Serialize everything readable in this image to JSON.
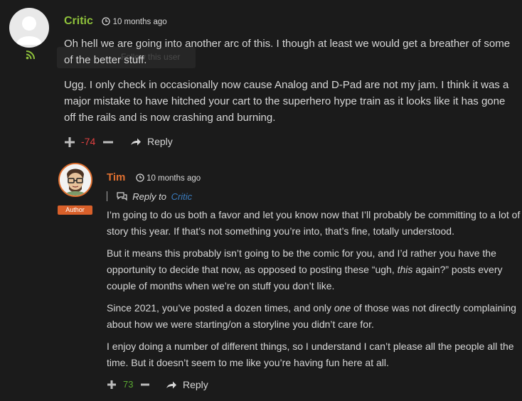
{
  "comment": {
    "author": "Critic",
    "time": "10 months ago",
    "tooltip": "Follow this user",
    "paragraphs": [
      "Oh hell we are going into another arc of this. I though at least we would get a breather of some of the better stuff.",
      "Ugg. I only check in occasionally now cause Analog and D-Pad are not my jam. I think it was a major mistake to have hitched your cart to the superhero hype train as it looks like it has gone off the rails and is now crashing and burning."
    ],
    "score": "-74",
    "reply_label": "Reply"
  },
  "reply": {
    "author": "Tim",
    "badge": "Author",
    "time": "10 months ago",
    "reply_to_prefix": "Reply to",
    "reply_to_name": "Critic",
    "p1": "I’m going to do us both a favor and let you know now that I’ll probably be committing to a lot of story this year. If that’s not something you’re into, that’s fine, totally understood.",
    "p2a": "But it means this probably isn’t going to be the comic for you, and I’d rather you have the opportunity to decide that now, as opposed to posting these “ugh, ",
    "p2em": "this",
    "p2b": " again?” posts every couple of months when we’re on stuff you don’t like.",
    "p3a": "Since 2021, you’ve posted a dozen times, and only ",
    "p3em": "one",
    "p3b": " of those was not directly complaining about how we were starting/on a storyline you didn’t care for.",
    "p4": "I enjoy doing a number of different things, so I understand I can’t please all the people all the time. But it doesn’t seem to me like you’re having fun here at all.",
    "score": "73",
    "reply_label": "Reply"
  },
  "colors": {
    "critic_name": "#8fc23b",
    "tim_name": "#e07030",
    "negative": "#e04040",
    "positive": "#5aa832",
    "link": "#3a7bbd"
  }
}
